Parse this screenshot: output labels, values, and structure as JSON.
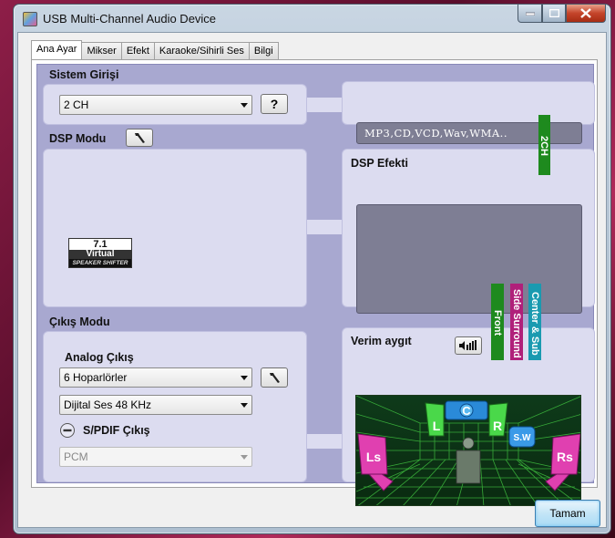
{
  "window": {
    "title": "USB Multi-Channel Audio Device"
  },
  "tabs": [
    {
      "label": "Ana Ayar"
    },
    {
      "label": "Mikser"
    },
    {
      "label": "Efekt"
    },
    {
      "label": "Karaoke/Sihirli Ses"
    },
    {
      "label": "Bilgi"
    }
  ],
  "system_input": {
    "label": "Sistem Girişi",
    "selected": "2 CH",
    "help_label": "?",
    "media_text": "MP3,CD,VCD,Wav,WMA.."
  },
  "dsp_mode": {
    "label": "DSP Modu",
    "badge": {
      "line1": "7.1",
      "line2": "Virtual",
      "line3": "SPEAKER SHIFTER"
    }
  },
  "dsp_effect": {
    "label": "DSP Efekti"
  },
  "strips": {
    "two_ch": "2CH",
    "front": "Front",
    "side_surround": "Side Surround",
    "center_sub": "Center & Sub"
  },
  "output_mode": {
    "label": "Çıkış Modu",
    "analog_label": "Analog Çıkış",
    "analog_selected": "6 Hoparlörler",
    "digital_selected": "Dijital Ses 48 KHz",
    "spdif_label": "S/PDIF Çıkış",
    "spdif_selected": "PCM"
  },
  "device": {
    "label": "Verim aygıt",
    "speakers": {
      "c": "C",
      "l": "L",
      "r": "R",
      "sw": "S.W",
      "ls": "Ls",
      "rs": "Rs"
    }
  },
  "footer": {
    "ok_label": "Tamam"
  },
  "colors": {
    "panel": "#a8a8d0",
    "box": "#dcdcf0",
    "strip_green": "#1e8a1e",
    "strip_magenta": "#b0207a",
    "strip_cyan": "#1a9ab0"
  }
}
